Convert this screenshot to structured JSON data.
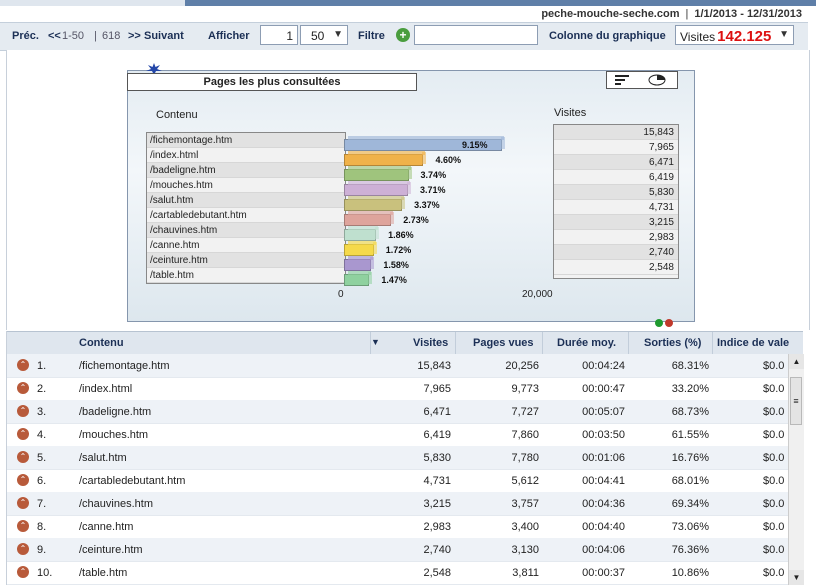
{
  "header": {
    "site": "peche-mouche-seche.com",
    "date_range": "1/1/2013 - 12/31/2013",
    "separator": "|"
  },
  "toolbar": {
    "prev_label": "Préc.",
    "prev_arrows": "<<",
    "range": "1-50",
    "pipe": "|",
    "total": "618",
    "next_arrows": ">>",
    "next_label": "Suivant",
    "show_label": "Afficher",
    "start_value": "1",
    "page_size": "50",
    "filter_label": "Filtre",
    "filter_value": "",
    "chart_column_label": "Colonne du graphique",
    "chart_column_value": "Visites",
    "chart_column_metric": "142.125"
  },
  "chart": {
    "title": "Pages les plus consultées",
    "col_content": "Contenu",
    "col_visits": "Visites",
    "axis_min_label": "0",
    "axis_max_label": "20,000"
  },
  "chart_data": {
    "type": "bar",
    "title": "Pages les plus consultées",
    "categories": [
      "/fichemontage.htm",
      "/index.html",
      "/badeligne.htm",
      "/mouches.htm",
      "/salut.htm",
      "/cartabledebutant.htm",
      "/chauvines.htm",
      "/canne.htm",
      "/ceinture.htm",
      "/table.htm"
    ],
    "values": [
      15843,
      7965,
      6471,
      6419,
      5830,
      4731,
      3215,
      2983,
      2740,
      2548
    ],
    "value_labels": [
      "15,843",
      "7,965",
      "6,471",
      "6,419",
      "5,830",
      "4,731",
      "3,215",
      "2,983",
      "2,740",
      "2,548"
    ],
    "percent_labels": [
      "9.15%",
      "4.60%",
      "3.74%",
      "3.71%",
      "3.37%",
      "2.73%",
      "1.86%",
      "1.72%",
      "1.58%",
      "1.47%"
    ],
    "colors": [
      "#9fb7d9",
      "#f0b24a",
      "#9fc47d",
      "#cdb0d6",
      "#c9c17d",
      "#dea49c",
      "#bfe0cf",
      "#f5d94a",
      "#a997cf",
      "#8fd19f"
    ],
    "xlim": [
      0,
      20000
    ],
    "xlabel": "",
    "ylabel": "",
    "grid": false
  },
  "table": {
    "headers": {
      "content": "Contenu",
      "visits": "Visites",
      "pageviews": "Pages vues",
      "avg_duration": "Durée moy.",
      "exits": "Sorties (%)",
      "value_index": "Indice de vale"
    },
    "rows": [
      {
        "rank": "1.",
        "page": "/fichemontage.htm",
        "visits": "15,843",
        "pageviews": "20,256",
        "duration": "00:04:24",
        "exits": "68.31%",
        "index": "$0.0"
      },
      {
        "rank": "2.",
        "page": "/index.html",
        "visits": "7,965",
        "pageviews": "9,773",
        "duration": "00:00:47",
        "exits": "33.20%",
        "index": "$0.0"
      },
      {
        "rank": "3.",
        "page": "/badeligne.htm",
        "visits": "6,471",
        "pageviews": "7,727",
        "duration": "00:05:07",
        "exits": "68.73%",
        "index": "$0.0"
      },
      {
        "rank": "4.",
        "page": "/mouches.htm",
        "visits": "6,419",
        "pageviews": "7,860",
        "duration": "00:03:50",
        "exits": "61.55%",
        "index": "$0.0"
      },
      {
        "rank": "5.",
        "page": "/salut.htm",
        "visits": "5,830",
        "pageviews": "7,780",
        "duration": "00:01:06",
        "exits": "16.76%",
        "index": "$0.0"
      },
      {
        "rank": "6.",
        "page": "/cartabledebutant.htm",
        "visits": "4,731",
        "pageviews": "5,612",
        "duration": "00:04:41",
        "exits": "68.01%",
        "index": "$0.0"
      },
      {
        "rank": "7.",
        "page": "/chauvines.htm",
        "visits": "3,215",
        "pageviews": "3,757",
        "duration": "00:04:36",
        "exits": "69.34%",
        "index": "$0.0"
      },
      {
        "rank": "8.",
        "page": "/canne.htm",
        "visits": "2,983",
        "pageviews": "3,400",
        "duration": "00:04:40",
        "exits": "73.06%",
        "index": "$0.0"
      },
      {
        "rank": "9.",
        "page": "/ceinture.htm",
        "visits": "2,740",
        "pageviews": "3,130",
        "duration": "00:04:06",
        "exits": "76.36%",
        "index": "$0.0"
      },
      {
        "rank": "10.",
        "page": "/table.htm",
        "visits": "2,548",
        "pageviews": "3,811",
        "duration": "00:00:37",
        "exits": "10.86%",
        "index": "$0.0"
      }
    ]
  },
  "icons": {
    "sort": "sort-desc-icon",
    "row": "row-expand-icon",
    "plus": "add-filter-icon"
  }
}
